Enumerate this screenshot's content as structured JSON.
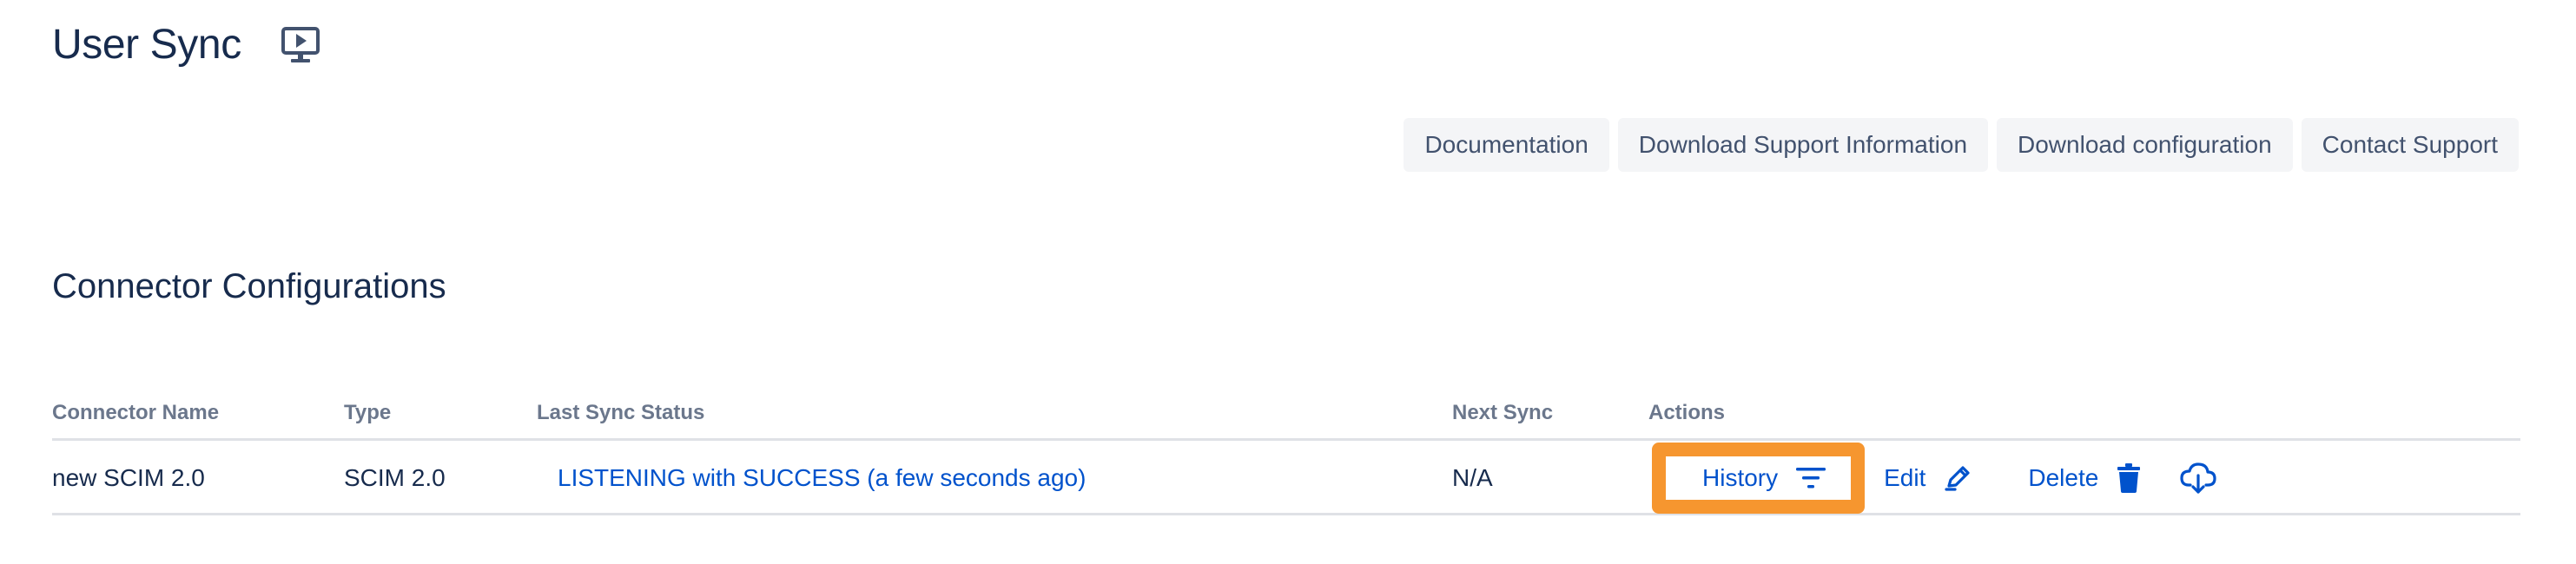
{
  "page": {
    "title": "User Sync",
    "tutorial_icon": "play-screen-icon"
  },
  "toolbar": {
    "buttons": [
      {
        "label": "Documentation"
      },
      {
        "label": "Download Support Information"
      },
      {
        "label": "Download configuration"
      },
      {
        "label": "Contact Support"
      }
    ]
  },
  "section": {
    "title": "Connector Configurations"
  },
  "table": {
    "columns": [
      "Connector Name",
      "Type",
      "Last Sync Status",
      "Next Sync",
      "Actions"
    ],
    "rows": [
      {
        "name": "new SCIM 2.0",
        "type": "SCIM 2.0",
        "last_sync_status": "LISTENING with SUCCESS (a few seconds ago)",
        "next_sync": "N/A",
        "actions": {
          "history": "History",
          "edit": "Edit",
          "delete": "Delete"
        }
      }
    ]
  },
  "icons": {
    "history": "filter-icon",
    "edit": "pencil-icon",
    "delete": "trash-icon",
    "export": "cloud-download-icon"
  },
  "colors": {
    "link": "#0052cc",
    "highlight": "#f6962f",
    "heading": "#172b4d",
    "muted": "#6b778c",
    "button_bg": "#f4f5f7"
  }
}
